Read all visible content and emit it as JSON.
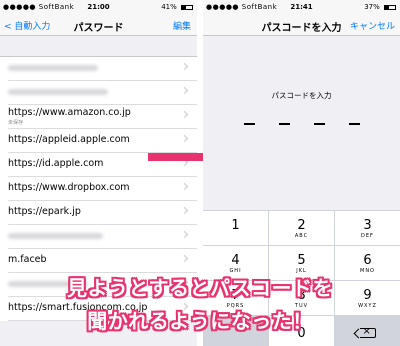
{
  "left": {
    "status": {
      "carrier": "●●●●● SoftBank",
      "time": "21:00",
      "battery": "41%",
      "battery_level": 0.41
    },
    "nav": {
      "back": "< 自動入力",
      "title": "パスワード",
      "edit": "編集"
    },
    "rows": [
      {
        "text": "",
        "sub": "",
        "blurred": true,
        "blurw": 90
      },
      {
        "text": "",
        "sub": "",
        "blurred": true,
        "blurw": 100
      },
      {
        "text": "https://www.amazon.co.jp",
        "sub": "未保存",
        "blurred": false
      },
      {
        "text": "https://appleid.apple.com",
        "sub": "",
        "blurred": false
      },
      {
        "text": "https://id.apple.com",
        "sub": "",
        "blurred": false
      },
      {
        "text": "https://www.dropbox.com",
        "sub": "",
        "blurred": false
      },
      {
        "text": "https://epark.jp",
        "sub": "",
        "blurred": false
      },
      {
        "text": "",
        "sub": "",
        "blurred": true,
        "blurw": 95
      },
      {
        "text": "m.faceb",
        "sub": "",
        "blurred": false
      },
      {
        "text": "",
        "sub": "",
        "blurred": true,
        "blurw": 80
      },
      {
        "text": "https://smart.fusioncom.co.jp",
        "sub": "",
        "blurred": false
      }
    ]
  },
  "right": {
    "status": {
      "carrier": "●●●●● SoftBank",
      "time": "21:41",
      "battery": "37%",
      "battery_level": 0.37
    },
    "nav": {
      "title": "パスコードを入力",
      "cancel": "キャンセル"
    },
    "prompt": "パスコードを入力",
    "keys": [
      {
        "num": "1",
        "letters": ""
      },
      {
        "num": "2",
        "letters": "ABC"
      },
      {
        "num": "3",
        "letters": "DEF"
      },
      {
        "num": "4",
        "letters": "GHI"
      },
      {
        "num": "5",
        "letters": "JKL"
      },
      {
        "num": "6",
        "letters": "MNO"
      },
      {
        "num": "7",
        "letters": "PQRS"
      },
      {
        "num": "8",
        "letters": "TUV"
      },
      {
        "num": "9",
        "letters": "WXYZ"
      },
      {
        "num": "",
        "letters": "",
        "type": "blank"
      },
      {
        "num": "0",
        "letters": "",
        "type": "zero"
      },
      {
        "num": "",
        "letters": "",
        "type": "del"
      }
    ]
  },
  "caption": {
    "line1": "見ようとするとパスコードを",
    "line2": "聞かれるようになった！"
  },
  "colors": {
    "accent": "#007aff",
    "caption_outline": "#e8336f",
    "arrow": "#e8336f"
  }
}
